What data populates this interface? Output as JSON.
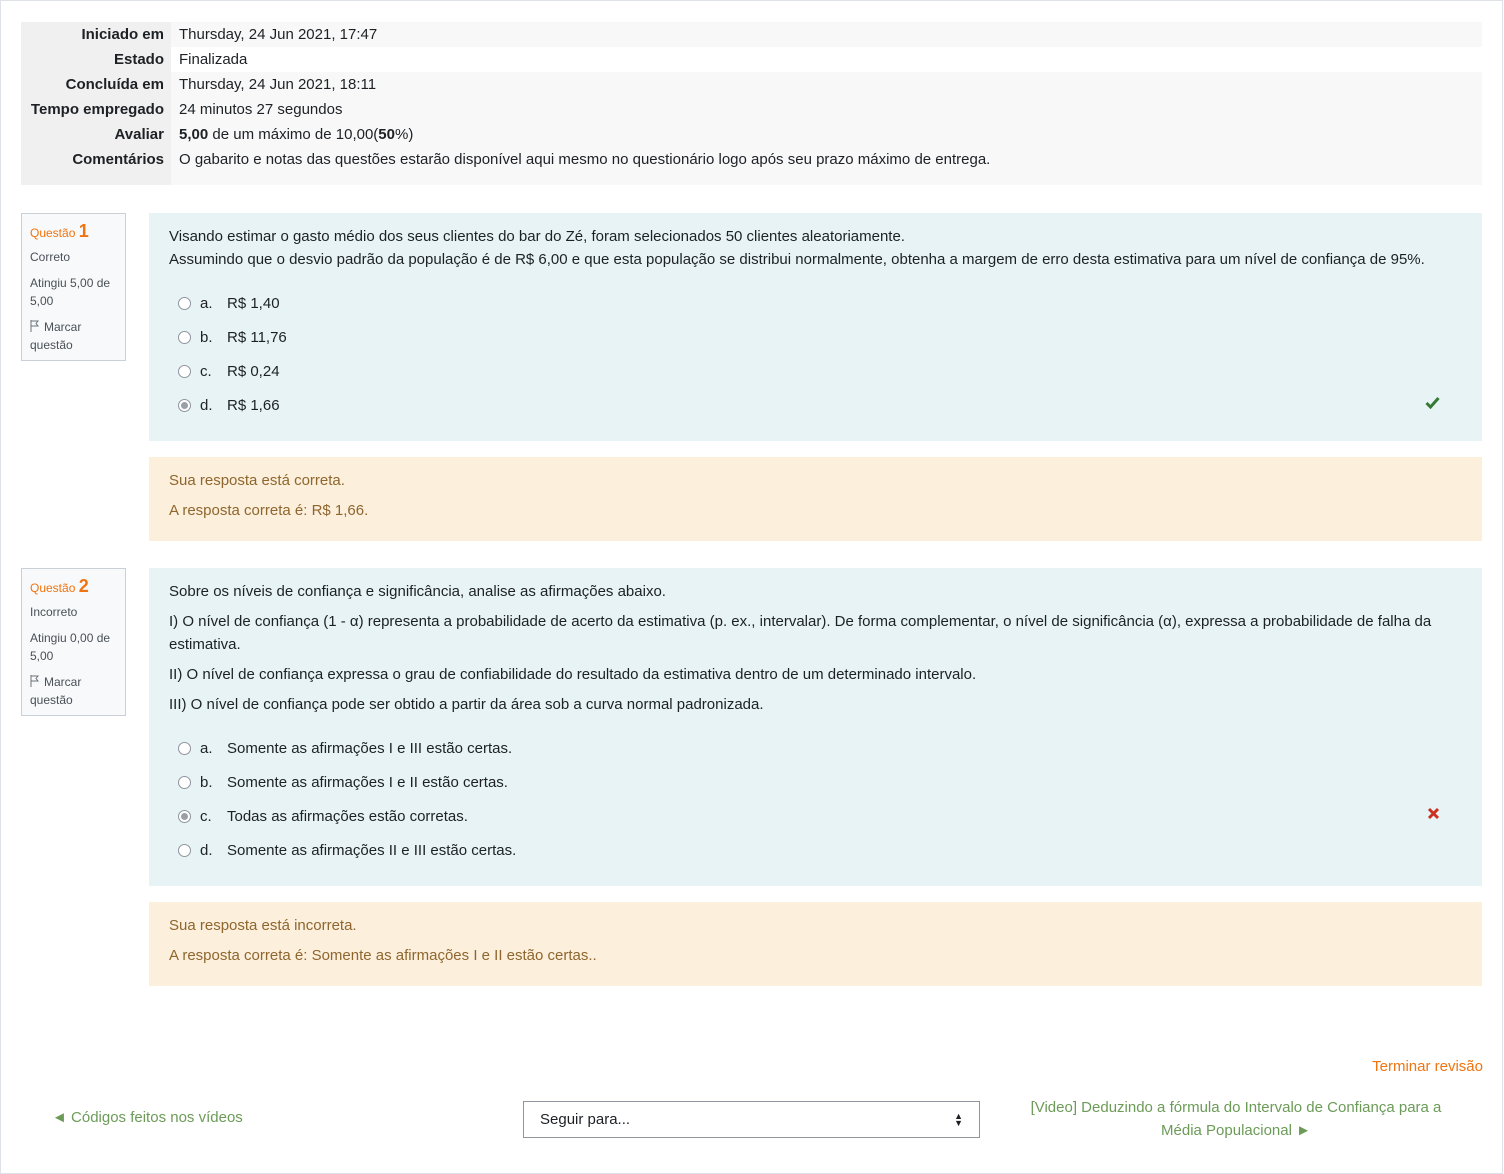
{
  "summary": [
    {
      "label": "Iniciado em",
      "value": "Thursday, 24 Jun 2021, 17:47"
    },
    {
      "label": "Estado",
      "value": "Finalizada"
    },
    {
      "label": "Concluída em",
      "value": "Thursday, 24 Jun 2021, 18:11"
    },
    {
      "label": "Tempo empregado",
      "value": "24 minutos 27 segundos"
    },
    {
      "label": "Avaliar",
      "score": "5,00",
      "mid": " de um máximo de 10,00(",
      "percent": "50",
      "end": "%)"
    },
    {
      "label": "Comentários",
      "value": "O gabarito e notas das questões estarão disponível aqui mesmo no questionário logo após seu prazo máximo de entrega."
    }
  ],
  "questions": [
    {
      "prefix": "Questão",
      "number": "1",
      "state": "Correto",
      "grade": "Atingiu 5,00 de 5,00",
      "flag": "Marcar questão",
      "text": [
        "Visando estimar o gasto médio dos seus clientes do bar do Zé, foram selecionados 50 clientes aleatoriamente.",
        "Assumindo que o desvio padrão da população é de R$ 6,00 e que esta população se distribui normalmente, obtenha a margem de erro desta estimativa para um nível de confiança de 95%."
      ],
      "options": [
        {
          "letter": "a.",
          "text": "R$ 1,40"
        },
        {
          "letter": "b.",
          "text": "R$ 11,76"
        },
        {
          "letter": "c.",
          "text": "R$ 0,24"
        },
        {
          "letter": "d.",
          "text": "R$ 1,66"
        }
      ],
      "selected": "d",
      "mark_icon": "check-icon",
      "mark_color": "#357a32",
      "feedback": [
        "Sua resposta está correta.",
        "A resposta correta é: R$ 1,66."
      ]
    },
    {
      "prefix": "Questão",
      "number": "2",
      "state": "Incorreto",
      "grade": "Atingiu 0,00 de 5,00",
      "flag": "Marcar questão",
      "text": [
        "Sobre os níveis de confiança e significância, analise as afirmações abaixo.",
        "I) O nível de confiança (1 - α) representa a probabilidade de acerto da estimativa (p. ex., intervalar). De forma complementar, o nível de significância (α), expressa a probabilidade de falha da estimativa.",
        "II) O nível de confiança expressa o grau de confiabilidade do resultado da estimativa dentro de um determinado intervalo.",
        "III) O nível de confiança pode ser obtido a partir da área sob a curva normal padronizada."
      ],
      "options": [
        {
          "letter": "a.",
          "text": "Somente as afirmações I e III estão certas."
        },
        {
          "letter": "b.",
          "text": "Somente as afirmações I e II estão certas."
        },
        {
          "letter": "c.",
          "text": "Todas as afirmações estão corretas."
        },
        {
          "letter": "d.",
          "text": "Somente as afirmações II e III estão certas."
        }
      ],
      "selected": "c",
      "mark_icon": "cross-icon",
      "mark_color": "#ca3120",
      "feedback": [
        "Sua resposta está incorreta.",
        "A resposta correta é: Somente as afirmações I e II estão certas.."
      ]
    }
  ],
  "nav": {
    "finish": "Terminar revisão",
    "prev": "◄ Códigos feitos nos vídeos",
    "jump": "Seguir para...",
    "next": "[Video] Deduzindo a fórmula do Intervalo de Confiança para a Média Populacional ►"
  }
}
